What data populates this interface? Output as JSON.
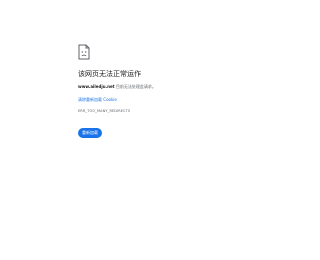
{
  "icon": "broken-page-icon",
  "title": "该网页无法正常运作",
  "description": {
    "domain": "www.ailedju.net",
    "message": " 目前无法处理此请求。"
  },
  "cookie_link": "清除重新加载 Cookie",
  "error_code": "ERR_TOO_MANY_REDIRECTS",
  "reload_button": "重新加载",
  "colors": {
    "accent": "#1a73e8",
    "text": "#202124",
    "secondary_text": "#5f6368"
  }
}
